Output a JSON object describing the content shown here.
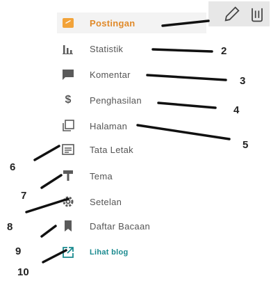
{
  "menu": {
    "items": [
      {
        "label": "Postingan",
        "icon": "posts-icon"
      },
      {
        "label": "Statistik",
        "icon": "stats-icon"
      },
      {
        "label": "Komentar",
        "icon": "comment-icon"
      },
      {
        "label": "Penghasilan",
        "icon": "dollar-icon"
      },
      {
        "label": "Halaman",
        "icon": "pages-icon"
      },
      {
        "label": "Tata Letak",
        "icon": "layout-icon"
      },
      {
        "label": "Tema",
        "icon": "theme-icon"
      },
      {
        "label": "Setelan",
        "icon": "gear-icon"
      },
      {
        "label": "Daftar Bacaan",
        "icon": "bookmark-icon"
      },
      {
        "label": "Lihat blog",
        "icon": "external-link-icon"
      }
    ]
  },
  "toolbar": {
    "icons": [
      "pencil-icon",
      "trash-icon"
    ]
  },
  "annotations": {
    "numbers": [
      "2",
      "3",
      "4",
      "5",
      "6",
      "7",
      "8",
      "9",
      "10"
    ]
  },
  "colors": {
    "active": "#e08a2a",
    "icon": "#5a5a5a",
    "link": "#1a8a8f"
  }
}
